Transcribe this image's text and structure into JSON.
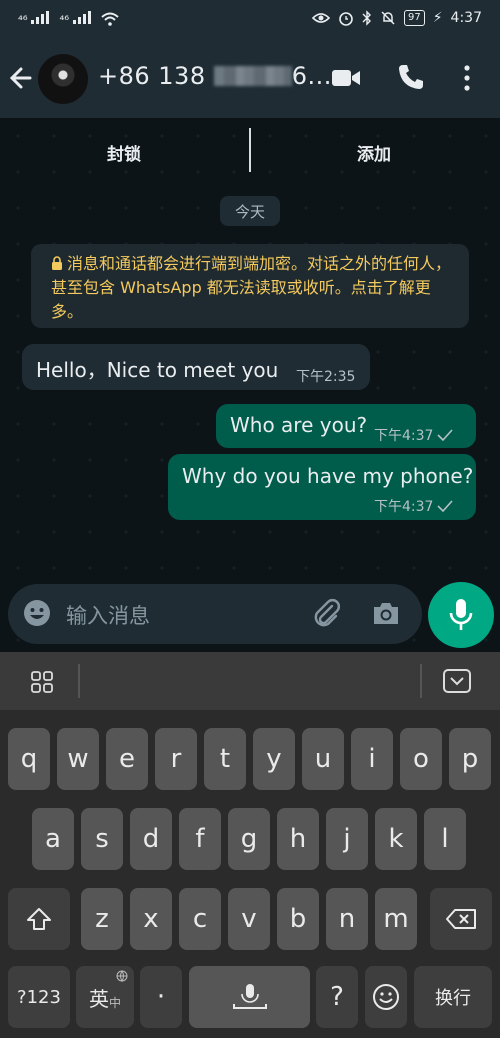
{
  "status_bar": {
    "signal1": "⁴⁶",
    "signal2": "⁴⁶",
    "battery": "97",
    "time": "4:37"
  },
  "header": {
    "contact": "+86 138",
    "contact_suffix": "6..."
  },
  "top_buttons": {
    "block": "封锁",
    "add": "添加"
  },
  "chat": {
    "date": "今天",
    "notice": "消息和通话都会进行端到端加密。对话之外的任何人，甚至包含 WhatsApp 都无法读取或收听。点击了解更多。",
    "messages": [
      {
        "text": "Hello，Nice to meet you",
        "time": "下午2:35",
        "direction": "incoming"
      },
      {
        "text": "Who are you?",
        "time": "下午4:37",
        "direction": "outgoing"
      },
      {
        "text": "Why do you have my phone?",
        "time": "下午4:37",
        "direction": "outgoing"
      }
    ]
  },
  "input": {
    "placeholder": "输入消息"
  },
  "keyboard": {
    "row1": [
      "q",
      "w",
      "e",
      "r",
      "t",
      "y",
      "u",
      "i",
      "o",
      "p"
    ],
    "row2": [
      "a",
      "s",
      "d",
      "f",
      "g",
      "h",
      "j",
      "k",
      "l"
    ],
    "row3": [
      "z",
      "x",
      "c",
      "v",
      "b",
      "n",
      "m"
    ],
    "symbols": "?123",
    "lang": "英",
    "lang_sub": "中",
    "dot": "·",
    "question": "?",
    "enter": "换行"
  },
  "colors": {
    "accent": "#00a884",
    "outgoing_bubble": "#005c4b",
    "notice_text": "#f4c95d"
  }
}
